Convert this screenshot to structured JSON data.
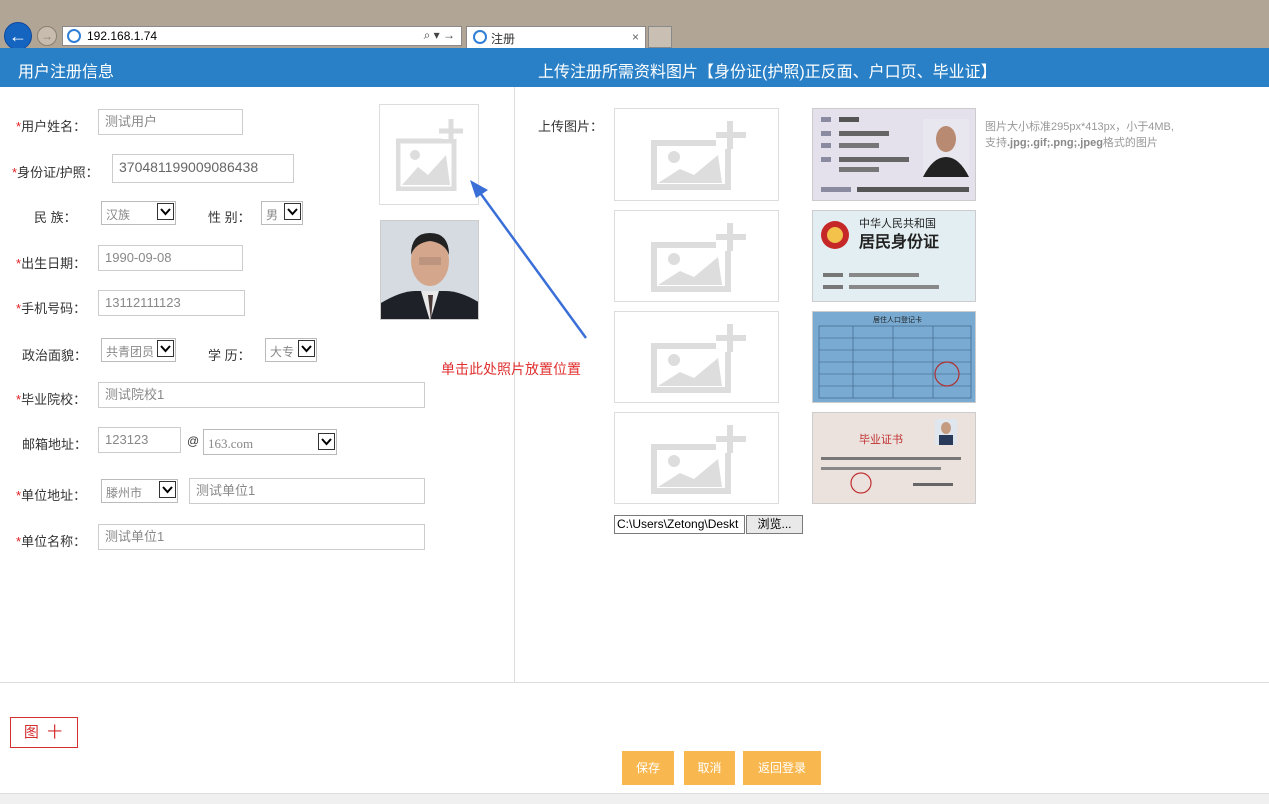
{
  "browser": {
    "url": "192.168.1.74",
    "search_tools": "⌕ ▾ →",
    "tab_title": "注册",
    "tab_close": "×"
  },
  "header": {
    "left_title": "用户注册信息",
    "right_title": "上传注册所需资料图片【身份证(护照)正反面、户口页、毕业证】"
  },
  "form": {
    "required_mark": "*",
    "name_label": "用户姓名：",
    "name_value": "测试用户",
    "id_label": "身份证/护照：",
    "id_value": "370481199009086438",
    "ethnic_label": "民 族：",
    "ethnic_value": "汉族",
    "gender_label": "性 别：",
    "gender_value": "男",
    "birth_label": "出生日期：",
    "birth_value": "1990-09-08",
    "phone_label": "手机号码：",
    "phone_value": "13112111123",
    "political_label": "政治面貌：",
    "political_value": "共青团员",
    "edu_label": "学 历：",
    "edu_value": "大专",
    "school_label": "毕业院校：",
    "school_value": "测试院校1",
    "email_label": "邮箱地址：",
    "email_user": "123123",
    "email_at": "@",
    "email_domain": "163.com",
    "work_addr_label": "单位地址：",
    "work_city": "滕州市",
    "work_addr_value": "测试单位1",
    "work_name_label": "单位名称：",
    "work_name_value": "测试单位1"
  },
  "annotation": {
    "text": "单击此处照片放置位置",
    "arrow_color": "#3a6fd8"
  },
  "upload": {
    "label": "上传图片：",
    "hint_line1": "图片大小标准295px*413px，小于4MB,",
    "hint_line2_prefix": "支持",
    "hint_line2_formats": ".jpg;.gif;.png;.jpeg",
    "hint_line2_suffix": "格式的图片",
    "file_path": "C:\\Users\\Zetong\\Deskt",
    "browse_label": "浏览...",
    "emblem_title": "中华人民共和国",
    "emblem_subtitle": "居民身份证",
    "hukou_title": "居住人口登记卡",
    "diploma_title": "毕业证书"
  },
  "buttons": {
    "save": "保存",
    "cancel": "取消",
    "back": "返回登录"
  },
  "figure_label": "图 十",
  "colors": {
    "header": "#2980c7",
    "required": "#e02020",
    "button": "#f9b84f",
    "annotation": "#e03030"
  }
}
